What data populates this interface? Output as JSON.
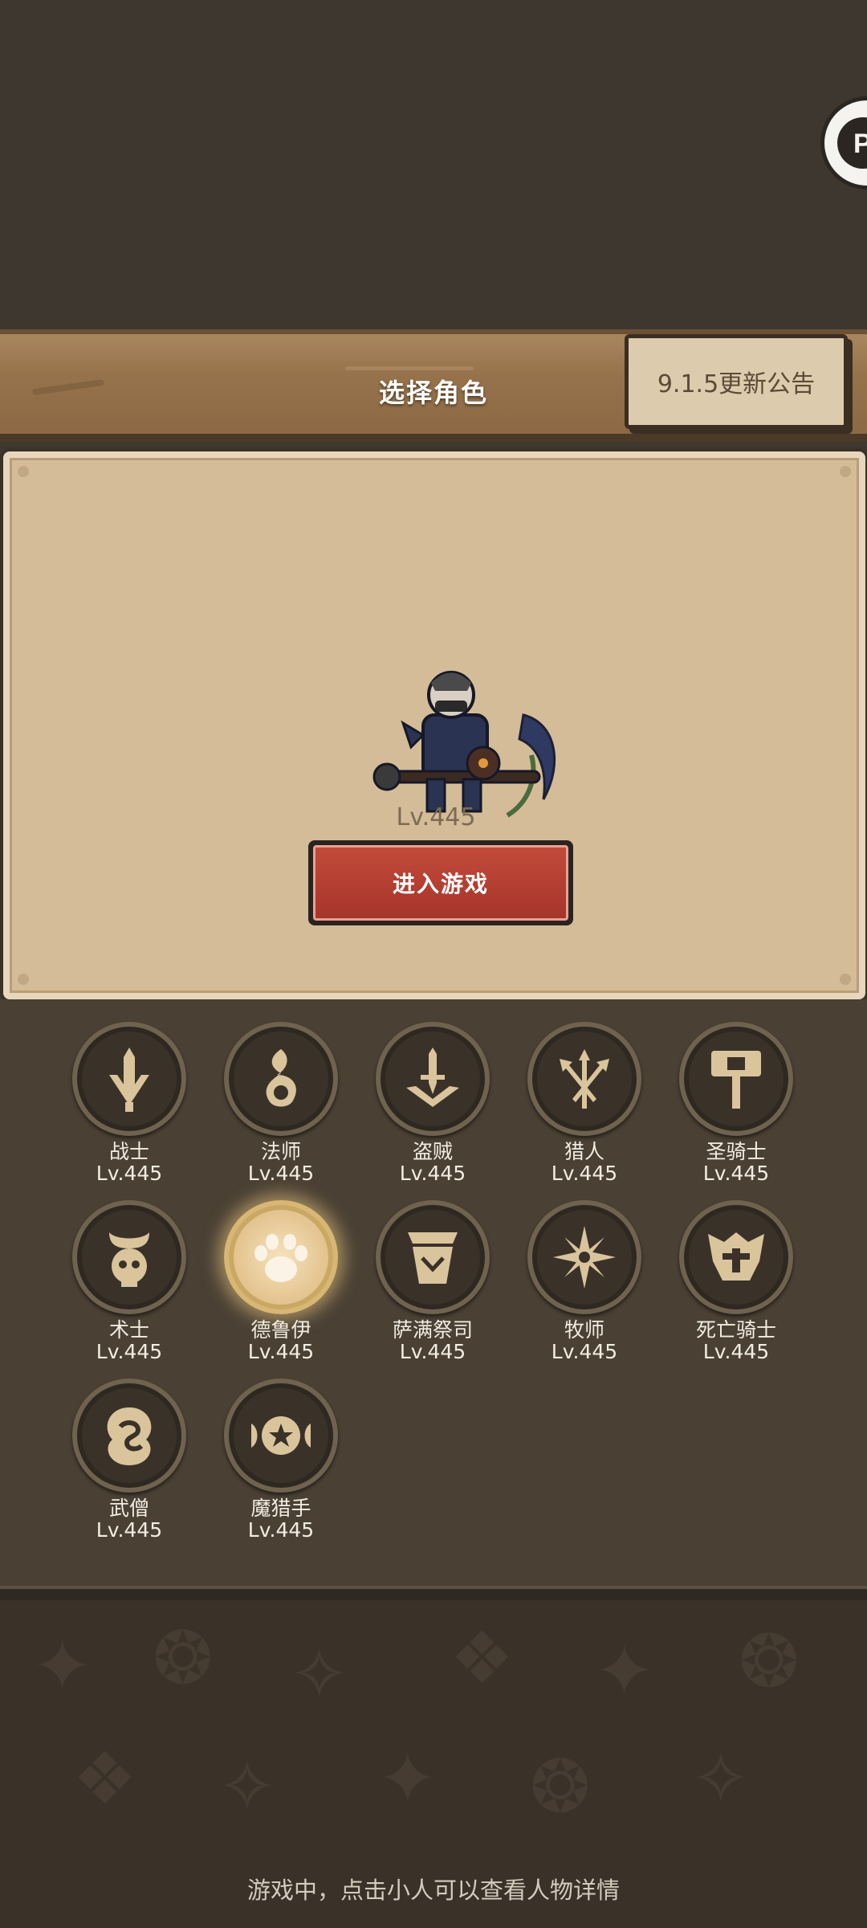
{
  "header": {
    "title": "选择角色",
    "notice_button": "9.1.5更新公告"
  },
  "character": {
    "level": "Lv.445",
    "enter_button": "进入游戏"
  },
  "classes": [
    {
      "name": "战士",
      "level": "Lv.445",
      "icon": "warrior-sword-icon"
    },
    {
      "name": "法师",
      "level": "Lv.445",
      "icon": "mage-flame-icon"
    },
    {
      "name": "盗贼",
      "level": "Lv.445",
      "icon": "rogue-dagger-icon"
    },
    {
      "name": "猎人",
      "level": "Lv.445",
      "icon": "hunter-arrows-icon"
    },
    {
      "name": "圣骑士",
      "level": "Lv.445",
      "icon": "paladin-hammer-icon"
    },
    {
      "name": "术士",
      "level": "Lv.445",
      "icon": "warlock-skull-icon"
    },
    {
      "name": "德鲁伊",
      "level": "Lv.445",
      "icon": "druid-paw-icon",
      "selected": true
    },
    {
      "name": "萨满祭司",
      "level": "Lv.445",
      "icon": "shaman-totem-icon"
    },
    {
      "name": "牧师",
      "level": "Lv.445",
      "icon": "priest-star-icon"
    },
    {
      "name": "死亡骑士",
      "level": "Lv.445",
      "icon": "death-knight-helm-icon"
    },
    {
      "name": "武僧",
      "level": "Lv.445",
      "icon": "monk-swirl-icon"
    },
    {
      "name": "魔猎手",
      "level": "Lv.445",
      "icon": "demon-hunter-icon"
    }
  ],
  "footer": {
    "hint": "游戏中，点击小人可以查看人物详情"
  },
  "colors": {
    "background": "#3f382f",
    "parchment": "#d4bc98",
    "enter_button": "#b23f31",
    "icon_gold": "#d9c49c"
  }
}
